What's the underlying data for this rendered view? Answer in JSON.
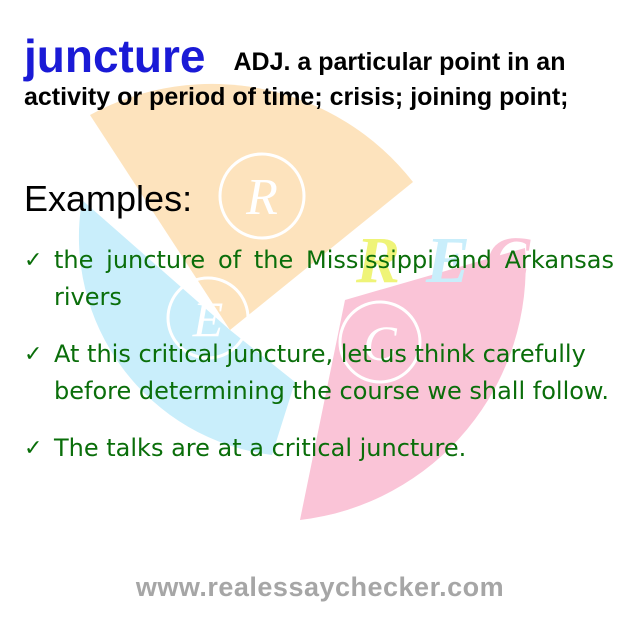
{
  "definition": {
    "word": "juncture",
    "text": "ADJ. a particular point in an activity or period of time; crisis; joining point;"
  },
  "examples": {
    "heading": "Examples:",
    "check_icon": "✓",
    "items": [
      "the juncture of the Mississippi and Arkansas rivers",
      "At this critical juncture, let us think carefully before determining the course we shall follow.",
      "The talks are at a critical juncture."
    ]
  },
  "logo": {
    "letters": [
      "R",
      "E",
      "C",
      "R",
      "E",
      "C"
    ]
  },
  "footer": {
    "url": "www.realessaychecker.com"
  },
  "colors": {
    "word": "#1a1ad6",
    "example_text": "#0a6e0a",
    "footer": "#a6a6a6",
    "logo_orange": "#fde3bd",
    "logo_blue": "#c9eefb",
    "logo_pink": "#fac4d7"
  }
}
